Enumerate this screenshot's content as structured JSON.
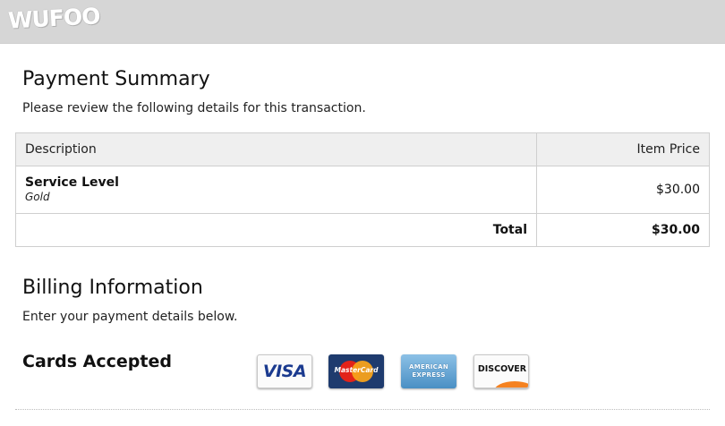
{
  "header": {
    "logo_text": "WUFOO"
  },
  "payment_summary": {
    "title": "Payment Summary",
    "description": "Please review the following details for this transaction.",
    "table": {
      "columns": [
        "Description",
        "Item Price"
      ],
      "items": [
        {
          "name": "Service Level",
          "option": "Gold",
          "price": "$30.00"
        }
      ],
      "total_label": "Total",
      "total_value": "$30.00"
    }
  },
  "billing": {
    "title": "Billing Information",
    "description": "Enter your payment details below.",
    "cards_label": "Cards Accepted",
    "cards": [
      {
        "name": "VISA",
        "icon": "visa-card-icon"
      },
      {
        "name": "MasterCard",
        "icon": "mastercard-card-icon"
      },
      {
        "name": "AMERICAN EXPRESS",
        "icon": "amex-card-icon"
      },
      {
        "name": "DISCOVER",
        "icon": "discover-card-icon"
      }
    ]
  },
  "colors": {
    "header_bg": "#d6d6d6",
    "table_header_bg": "#efefef",
    "table_border": "#cfcfcf"
  }
}
